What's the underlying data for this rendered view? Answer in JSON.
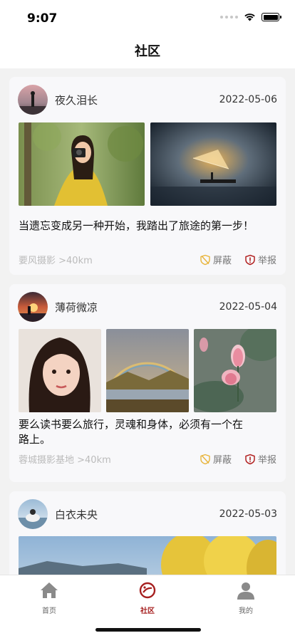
{
  "status_bar": {
    "time": "9:07"
  },
  "header": {
    "title": "社区"
  },
  "posts": [
    {
      "username": "夜久泪长",
      "date": "2022-05-06",
      "caption": "当遗忘变成另一种开始，我踏出了旅途的第一步！",
      "location": "要风摄影 >40km",
      "block_label": "屏蔽",
      "report_label": "举报"
    },
    {
      "username": "薄荷微凉",
      "date": "2022-05-04",
      "caption_line1": "要么读书要么旅行，灵魂和身体，必须有一个在",
      "caption_line2": "路上。",
      "location": "蓉城摄影基地 >40km",
      "block_label": "屏蔽",
      "report_label": "举报"
    },
    {
      "username": "白衣未央",
      "date": "2022-05-03"
    }
  ],
  "tabbar": {
    "items": [
      {
        "label": "首页",
        "icon": "home-icon"
      },
      {
        "label": "社区",
        "icon": "community-icon",
        "active": true
      },
      {
        "label": "我的",
        "icon": "profile-icon"
      }
    ]
  },
  "colors": {
    "accent": "#a61f1f",
    "block_icon": "#e8b43a",
    "report_icon": "#b22222"
  }
}
